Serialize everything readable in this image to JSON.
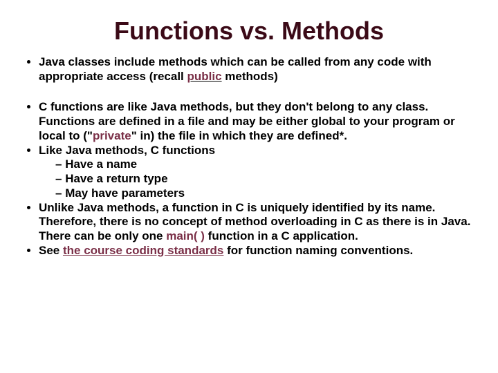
{
  "title": "Functions vs. Methods",
  "bullets": {
    "b1_a": "Java classes include methods which can be called from any code with appropriate access (recall ",
    "b1_kw": "public",
    "b1_b": " methods)",
    "b2_a": "C functions are like Java methods, but they don't belong to any class.  Functions are defined in a file and may be either global to your program or local to (\"",
    "b2_kw": "private",
    "b2_b": "\" in) the file in which they are defined*.",
    "b3": "Like Java methods, C functions",
    "b3_s1": "Have a name",
    "b3_s2": "Have a return type",
    "b3_s3": "May have  parameters",
    "b4_a": "Unlike Java methods, a function in C is uniquely identified by its name.  Therefore, there is no concept of method overloading in C as there is in Java.  There can be only one ",
    "b4_kw": "main( )",
    "b4_b": " function in a C application.",
    "b5_a": "See ",
    "b5_link": "the course coding standards",
    "b5_b": " for function naming conventions."
  }
}
